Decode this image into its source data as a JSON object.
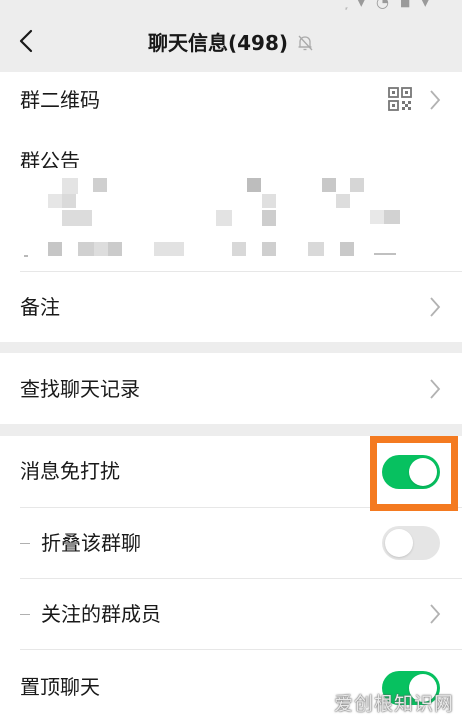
{
  "status_bar": {
    "glyphs": "᷊ ▾ ◔ ◾ ▾"
  },
  "header": {
    "title": "聊天信息(498)"
  },
  "rows": {
    "qr_code": "群二维码",
    "announcement": "群公告",
    "remark": "备注",
    "search_history": "查找聊天记录",
    "mute_notifications": "消息免打扰",
    "fold_chat": "折叠该群聊",
    "followed_members": "关注的群成员",
    "pin_chat": "置顶聊天"
  },
  "toggles": {
    "mute_notifications": true,
    "fold_chat": false,
    "pin_chat": true
  },
  "colors": {
    "accent_green": "#07c160",
    "highlight_orange": "#f47a20",
    "background": "#ededed"
  },
  "watermark": "爱创根知识网"
}
